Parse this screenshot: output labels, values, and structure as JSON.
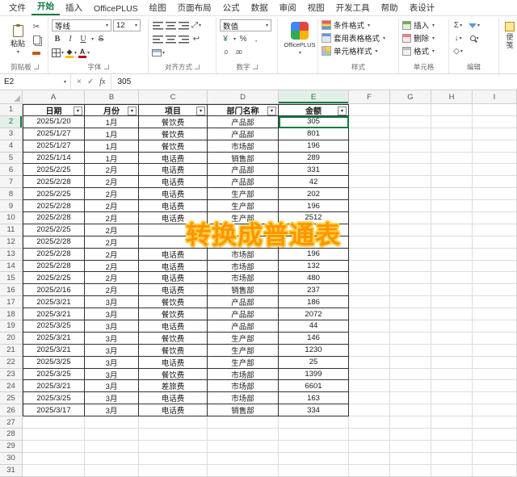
{
  "colors": {
    "accent_green": "#107c41",
    "table_border": "#2f2f2f",
    "overlay_orange": "#ff9500",
    "overlay_outline": "#ffd24d"
  },
  "ribbon": {
    "tabs": [
      {
        "label": "文件",
        "active": false
      },
      {
        "label": "开始",
        "active": true
      },
      {
        "label": "插入",
        "active": false
      },
      {
        "label": "OfficePLUS",
        "active": false
      },
      {
        "label": "绘图",
        "active": false
      },
      {
        "label": "页面布局",
        "active": false
      },
      {
        "label": "公式",
        "active": false
      },
      {
        "label": "数据",
        "active": false
      },
      {
        "label": "审阅",
        "active": false
      },
      {
        "label": "视图",
        "active": false
      },
      {
        "label": "开发工具",
        "active": false
      },
      {
        "label": "帮助",
        "active": false
      },
      {
        "label": "表设计",
        "active": false
      }
    ],
    "clipboard": {
      "paste_label": "粘贴",
      "group_label": "剪贴板"
    },
    "font": {
      "name": "等线",
      "size": "12",
      "group_label": "字体",
      "bold": "B",
      "italic": "I",
      "underline": "U"
    },
    "alignment": {
      "group_label": "对齐方式"
    },
    "number": {
      "format": "数值",
      "group_label": "数字",
      "percent": "%",
      "comma": ",",
      "currency": "¥",
      "dec0": ".0",
      "dec00": ".00"
    },
    "officeplus": {
      "label": "OfficePLUS"
    },
    "styles": {
      "buttons": [
        "条件格式",
        "套用表格格式",
        "单元格样式"
      ],
      "group_label": "样式"
    },
    "cells": {
      "buttons": [
        "插入",
        "删除",
        "格式"
      ],
      "group_label": "单元格"
    },
    "editing": {
      "group_label": "编辑",
      "sigma": "Σ",
      "fill": "↓",
      "clear": "◇"
    },
    "side_panel": {
      "label": "便笺"
    }
  },
  "formula_bar": {
    "name_box": "E2",
    "value": "305",
    "cancel": "×",
    "enter": "✓",
    "fx": "fx"
  },
  "sheet": {
    "column_letters": [
      "A",
      "B",
      "C",
      "D",
      "E",
      "F",
      "G",
      "H",
      "I"
    ],
    "visible_rows": 31,
    "selected_cell": "E2",
    "selected_column": "E",
    "selected_row": 2,
    "table": {
      "header": [
        "日期",
        "月份",
        "项目",
        "部门名称",
        "金额"
      ],
      "rows": [
        [
          "2025/1/20",
          "1月",
          "餐饮费",
          "产品部",
          "305"
        ],
        [
          "2025/1/27",
          "1月",
          "餐饮费",
          "产品部",
          "801"
        ],
        [
          "2025/1/27",
          "1月",
          "餐饮费",
          "市场部",
          "196"
        ],
        [
          "2025/1/14",
          "1月",
          "电话费",
          "销售部",
          "289"
        ],
        [
          "2025/2/25",
          "2月",
          "电话费",
          "产品部",
          "331"
        ],
        [
          "2025/2/28",
          "2月",
          "电话费",
          "产品部",
          "42"
        ],
        [
          "2025/2/25",
          "2月",
          "电话费",
          "生产部",
          "202"
        ],
        [
          "2025/2/28",
          "2月",
          "电话费",
          "生产部",
          "196"
        ],
        [
          "2025/2/28",
          "2月",
          "电话费",
          "生产部",
          "2512"
        ],
        [
          "2025/2/25",
          "2月",
          "",
          "",
          ""
        ],
        [
          "2025/2/28",
          "2月",
          "",
          "",
          ""
        ],
        [
          "2025/2/28",
          "2月",
          "电话费",
          "市场部",
          "196"
        ],
        [
          "2025/2/28",
          "2月",
          "电话费",
          "市场部",
          "132"
        ],
        [
          "2025/2/25",
          "2月",
          "电话费",
          "市场部",
          "480"
        ],
        [
          "2025/2/16",
          "2月",
          "电话费",
          "销售部",
          "237"
        ],
        [
          "2025/3/21",
          "3月",
          "餐饮费",
          "产品部",
          "186"
        ],
        [
          "2025/3/21",
          "3月",
          "餐饮费",
          "产品部",
          "2072"
        ],
        [
          "2025/3/25",
          "3月",
          "电话费",
          "产品部",
          "44"
        ],
        [
          "2025/3/21",
          "3月",
          "餐饮费",
          "生产部",
          "146"
        ],
        [
          "2025/3/21",
          "3月",
          "餐饮费",
          "生产部",
          "1230"
        ],
        [
          "2025/3/25",
          "3月",
          "电话费",
          "生产部",
          "25"
        ],
        [
          "2025/3/25",
          "3月",
          "餐饮费",
          "市场部",
          "1399"
        ],
        [
          "2025/3/21",
          "3月",
          "差旅费",
          "市场部",
          "6601"
        ],
        [
          "2025/3/25",
          "3月",
          "电话费",
          "市场部",
          "163"
        ],
        [
          "2025/3/17",
          "3月",
          "电话费",
          "销售部",
          "334"
        ]
      ]
    }
  },
  "overlay": {
    "text": "转换成普通表"
  }
}
